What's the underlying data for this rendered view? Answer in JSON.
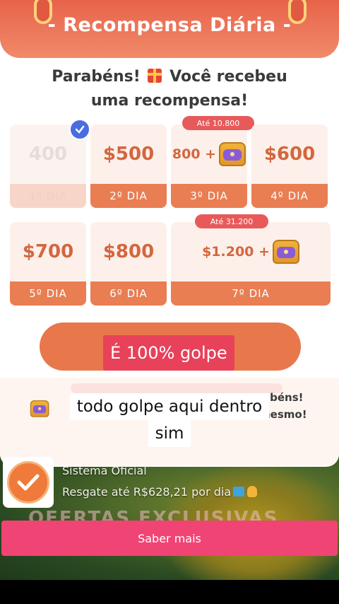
{
  "modal": {
    "title": "- Recompensa Diária -",
    "headline_part1": "Parabéns!",
    "headline_part2": "Você recebeu",
    "headline_line2": "uma recompensa!"
  },
  "days": [
    {
      "amount": "400",
      "label": "1º DIA",
      "claimed": true
    },
    {
      "amount": "$500",
      "label": "2º DIA"
    },
    {
      "amount": "800 +",
      "label": "3º DIA",
      "badge": "Até 10.800",
      "has_chest": true
    },
    {
      "amount": "$600",
      "label": "4º DIA"
    },
    {
      "amount": "$700",
      "label": "5º DIA"
    },
    {
      "amount": "$800",
      "label": "6º DIA"
    },
    {
      "amount": "$1.200 +",
      "label": "7º DIA",
      "badge": "Até 31.200",
      "has_chest": true
    }
  ],
  "captions": {
    "red": "É 100% golpe",
    "white_line1": "todo golpe aqui dentro",
    "white_line2": "sim"
  },
  "promo": {
    "right_line1": "abéns!",
    "right_line2": "nesmo!"
  },
  "notification": {
    "name": "Sistema Oficial",
    "description": "Resgate até R$628,21 por dia",
    "overlay_text": "OFERTAS EXCLUSIVAS",
    "button_label": "Saber mais"
  },
  "colors": {
    "accent": "#e97e52",
    "caption_red": "#e8415a",
    "button_pink": "#f04474"
  },
  "icons": [
    "gift-icon",
    "check-icon",
    "treasure-chest-icon",
    "checkmark-badge-icon",
    "pointing-hand-icon"
  ]
}
